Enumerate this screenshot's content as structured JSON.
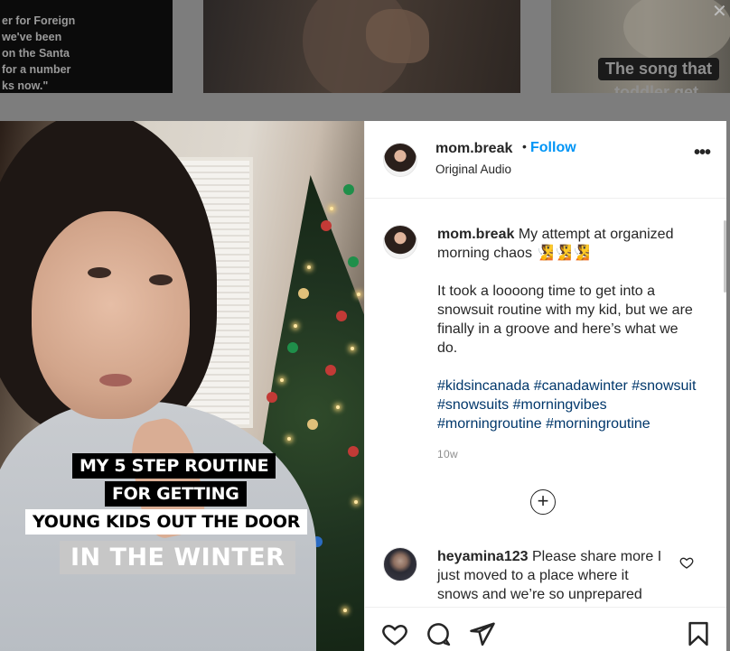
{
  "background_grid": {
    "thumb_1_caption": [
      "er for Foreign",
      "we've been",
      "on the Santa",
      "for a number",
      "ks now.\""
    ],
    "thumb_3_caption": "The song that",
    "thumb_3_caption_2": "toddler get"
  },
  "close_icon": "close-icon",
  "video": {
    "overlay_line_1": "MY 5 STEP ROUTINE",
    "overlay_line_2": "FOR GETTING",
    "overlay_line_3": "YOUNG KIDS OUT THE DOOR",
    "overlay_line_4": "IN THE WINTER"
  },
  "header": {
    "username": "mom.break",
    "separator": "•",
    "follow_label": "Follow",
    "audio_label": "Original Audio",
    "more_label": "•••"
  },
  "caption": {
    "username": "mom.break",
    "text_1": "My attempt at organized morning chaos",
    "emoji": "🧏🧏🧏",
    "text_2": "It took a loooong time to get into a snowsuit routine with my kid, but we are finally in a groove and here’s what we do.",
    "hashtags": "#kidsincanada #canadawinter #snowsuit #snowsuits #morningvibes #morningroutine #morningroutine",
    "time": "10w"
  },
  "load_more_icon": "plus-circle-icon",
  "comment": {
    "username": "heyamina123",
    "text": "Please share more I just moved to a place where it snows and we’re so unprepared"
  },
  "colors": {
    "follow": "#0095f6",
    "hashtag": "#00376b",
    "timestamp": "#8e8e8e",
    "overlay_dim": "#7d7d7d"
  }
}
